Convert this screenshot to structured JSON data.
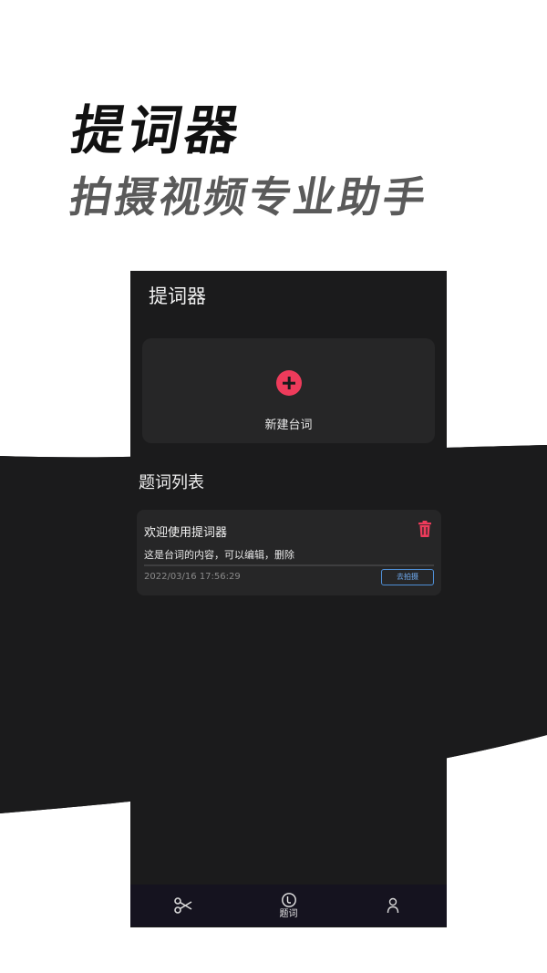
{
  "promo": {
    "title": "提词器",
    "subtitle": "拍摄视频专业助手"
  },
  "app": {
    "title": "提词器",
    "new_script_label": "新建台词",
    "section_title": "题词列表",
    "scripts": [
      {
        "title": "欢迎使用提词器",
        "content": "这是台词的内容，可以编辑，删除",
        "timestamp": "2022/03/16 17:56:29",
        "shoot_label": "去拍摄"
      }
    ],
    "tabs": [
      {
        "icon": "scissors-icon",
        "label": ""
      },
      {
        "icon": "teleprompter-icon",
        "label": "题词",
        "active": true
      },
      {
        "icon": "user-icon",
        "label": ""
      }
    ]
  },
  "colors": {
    "accent_red": "#ee3b5b",
    "link_blue": "#4f8fd6",
    "panel_bg": "#1b1b1c",
    "card_bg": "#262627"
  }
}
